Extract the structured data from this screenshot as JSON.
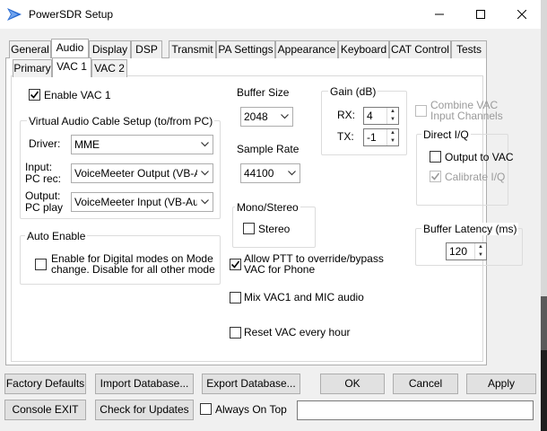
{
  "window": {
    "title": "PowerSDR Setup",
    "accent_icon_color": "#2a6bd1"
  },
  "tabs": [
    {
      "label": "General"
    },
    {
      "label": "Audio"
    },
    {
      "label": "Display"
    },
    {
      "label": "DSP"
    },
    {
      "label": "Transmit"
    },
    {
      "label": "PA Settings"
    },
    {
      "label": "Appearance"
    },
    {
      "label": "Keyboard"
    },
    {
      "label": "CAT Control"
    },
    {
      "label": "Tests"
    }
  ],
  "active_tab": "Audio",
  "subtabs": [
    {
      "label": "Primary"
    },
    {
      "label": "VAC 1"
    },
    {
      "label": "VAC 2"
    }
  ],
  "active_subtab": "VAC 1",
  "vac": {
    "enable_label": "Enable VAC 1",
    "enable_checked": true,
    "setup_group_title": "Virtual Audio Cable Setup (to/from PC)",
    "driver_label": "Driver:",
    "driver_value": "MME",
    "input_label_1": "Input:",
    "input_label_2": "PC rec:",
    "input_value": "VoiceMeeter Output (VB-Auc",
    "output_label_1": "Output:",
    "output_label_2": "PC play",
    "output_value": "VoiceMeeter Input (VB-Audic",
    "auto_enable_title": "Auto Enable",
    "auto_enable_line1": "Enable for Digital modes on Mode",
    "auto_enable_line2": "change.   Disable for  all other mode",
    "auto_enable_checked": false
  },
  "buffer": {
    "title": "Buffer Size",
    "value": "2048"
  },
  "sample_rate": {
    "title": "Sample Rate",
    "value": "44100"
  },
  "mono_stereo": {
    "title": "Mono/Stereo",
    "stereo_label": "Stereo",
    "stereo_checked": false
  },
  "gain": {
    "title": "Gain (dB)",
    "rx_label": "RX:",
    "rx_value": "4",
    "tx_label": "TX:",
    "tx_value": "-1"
  },
  "combine": {
    "line1": "Combine VAC",
    "line2": "Input Channels",
    "checked": false,
    "enabled": false
  },
  "direct_iq": {
    "title": "Direct I/Q",
    "output_label": "Output to VAC",
    "output_checked": false,
    "calibrate_label": "Calibrate I/Q",
    "calibrate_checked": true,
    "calibrate_enabled": false
  },
  "latency": {
    "title": "Buffer Latency (ms)",
    "value": "120"
  },
  "options": {
    "ptt_line1": "Allow PTT to override/bypass",
    "ptt_line2": "VAC for Phone",
    "ptt_checked": true,
    "mix_label": "Mix VAC1 and MIC audio",
    "mix_checked": false,
    "reset_label": "Reset VAC every hour",
    "reset_checked": false
  },
  "bottom": {
    "factory_defaults": "Factory Defaults",
    "import_db": "Import Database...",
    "export_db": "Export Database...",
    "ok": "OK",
    "cancel": "Cancel",
    "apply": "Apply",
    "console_exit": "Console EXIT",
    "check_updates": "Check for Updates",
    "always_on_top": "Always On Top",
    "always_on_top_checked": false,
    "status_text": ""
  }
}
